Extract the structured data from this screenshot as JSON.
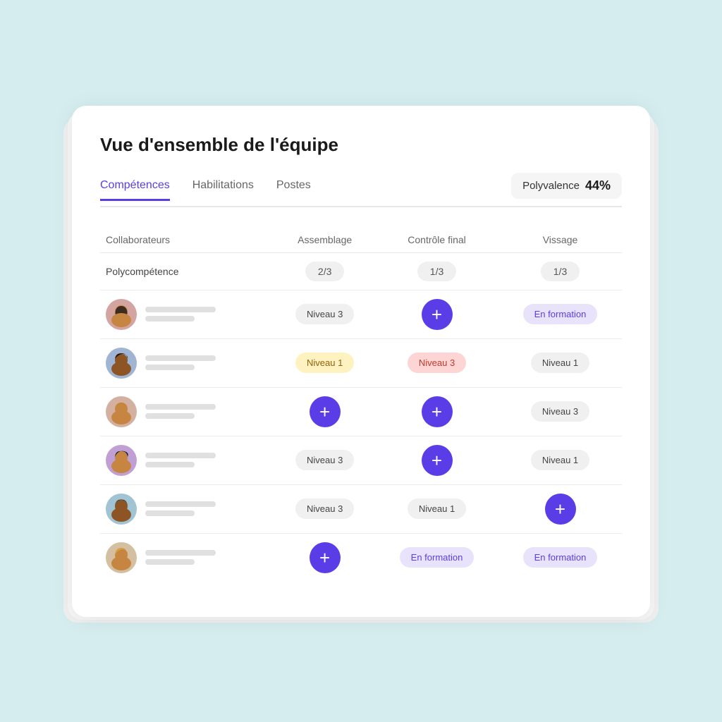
{
  "page": {
    "title": "Vue d'ensemble de l'équipe"
  },
  "tabs": [
    {
      "label": "Compétences",
      "active": true
    },
    {
      "label": "Habilitations",
      "active": false
    },
    {
      "label": "Postes",
      "active": false
    }
  ],
  "polyvalence": {
    "label": "Polyvalence",
    "value": "44%"
  },
  "table": {
    "headers": [
      "Collaborateurs",
      "Assemblage",
      "Contrôle final",
      "Vissage"
    ],
    "polycomp_row": {
      "label": "Polycompétence",
      "values": [
        "2/3",
        "1/3",
        "1/3"
      ]
    },
    "rows": [
      {
        "avatar_id": "avatar1",
        "assemblage": {
          "type": "badge-default",
          "text": "Niveau 3"
        },
        "controle": {
          "type": "plus",
          "text": "+"
        },
        "vissage": {
          "type": "badge-purple-light",
          "text": "En formation"
        }
      },
      {
        "avatar_id": "avatar2",
        "assemblage": {
          "type": "badge-yellow",
          "text": "Niveau 1"
        },
        "controle": {
          "type": "badge-pink",
          "text": "Niveau 3"
        },
        "vissage": {
          "type": "badge-default",
          "text": "Niveau 1"
        }
      },
      {
        "avatar_id": "avatar3",
        "assemblage": {
          "type": "plus",
          "text": "+"
        },
        "controle": {
          "type": "plus",
          "text": "+"
        },
        "vissage": {
          "type": "badge-default",
          "text": "Niveau 3"
        }
      },
      {
        "avatar_id": "avatar4",
        "assemblage": {
          "type": "badge-default",
          "text": "Niveau 3"
        },
        "controle": {
          "type": "plus",
          "text": "+"
        },
        "vissage": {
          "type": "badge-default",
          "text": "Niveau 1"
        }
      },
      {
        "avatar_id": "avatar5",
        "assemblage": {
          "type": "badge-default",
          "text": "Niveau 3"
        },
        "controle": {
          "type": "badge-default",
          "text": "Niveau 1"
        },
        "vissage": {
          "type": "plus",
          "text": "+"
        }
      },
      {
        "avatar_id": "avatar6",
        "assemblage": {
          "type": "plus",
          "text": "+"
        },
        "controle": {
          "type": "badge-purple-light",
          "text": "En formation"
        },
        "vissage": {
          "type": "badge-purple-light",
          "text": "En formation"
        }
      }
    ]
  },
  "avatars": {
    "avatar1": {
      "bg": "#d4a5a0",
      "skin": "#c68642",
      "hair": "#3d2b1f",
      "gender": "female"
    },
    "avatar2": {
      "bg": "#a0b4d4",
      "skin": "#8d5524",
      "hair": "#2c1a0e",
      "gender": "male"
    },
    "avatar3": {
      "bg": "#d4b0a0",
      "skin": "#c68642",
      "hair": "#c4832a",
      "gender": "female"
    },
    "avatar4": {
      "bg": "#c0a0d4",
      "skin": "#c68642",
      "hair": "#1a1a1a",
      "gender": "female"
    },
    "avatar5": {
      "bg": "#a0c4d4",
      "skin": "#8d5524",
      "hair": "#1a1a1a",
      "gender": "male"
    },
    "avatar6": {
      "bg": "#d4c0a0",
      "skin": "#c68642",
      "hair": "#d4a040",
      "gender": "female"
    }
  }
}
